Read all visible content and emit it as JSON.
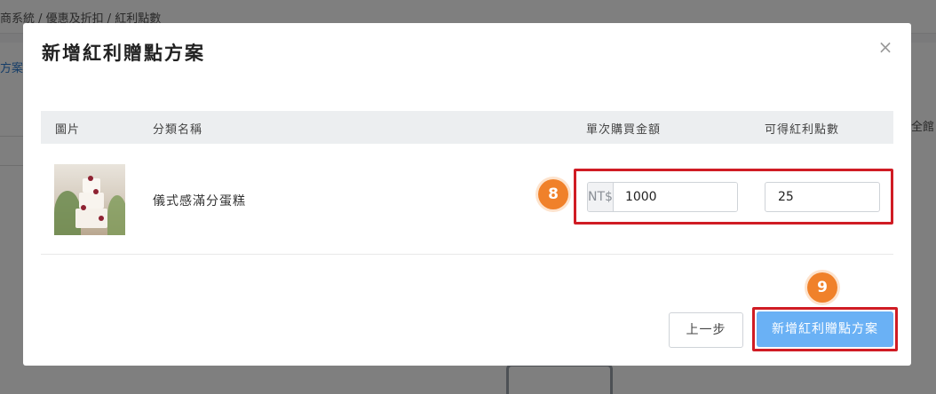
{
  "background": {
    "breadcrumb": "商系統 / 優惠及折扣 / 紅利點數",
    "tab_fragment": "方案",
    "right_fragment": "全館"
  },
  "modal": {
    "title": "新增紅利贈點方案",
    "close_icon": "×",
    "table": {
      "headers": [
        "圖片",
        "分類名稱",
        "單次購買金額",
        "可得紅利點數"
      ],
      "rows": [
        {
          "image_icon": "cake-photo",
          "name": "儀式感滿分蛋糕",
          "currency_addon": "NT$",
          "purchase_amount": "1000",
          "bonus_points": "25"
        }
      ]
    },
    "annotations": {
      "step_a": "8",
      "step_b": "9"
    },
    "buttons": {
      "prev": "上一步",
      "submit": "新增紅利贈點方案"
    }
  },
  "colors": {
    "highlight": "#d01c24",
    "badge": "#f0812a",
    "primary_button": "#6ab1f5"
  }
}
